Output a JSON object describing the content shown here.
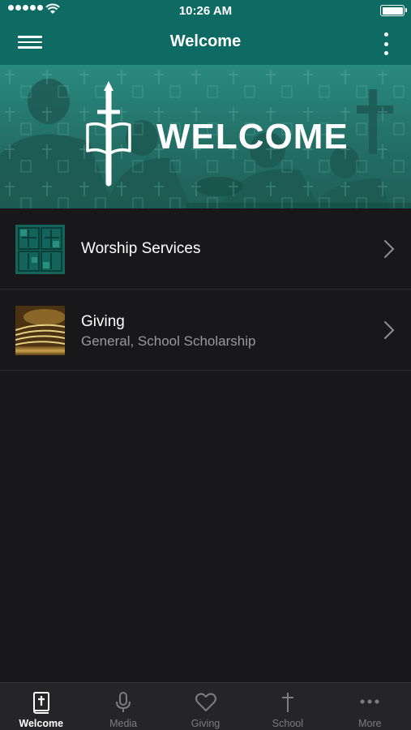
{
  "status_bar": {
    "time": "10:26 AM"
  },
  "navbar": {
    "title": "Welcome",
    "menu_icon": "hamburger-menu-icon",
    "more_icon": "vertical-ellipsis-icon"
  },
  "banner": {
    "text": "WELCOME",
    "logo_icon": "sword-bible-cross-icon"
  },
  "list": {
    "items": [
      {
        "title": "Worship Services",
        "subtitle": "",
        "thumb_icon": "stained-glass-thumbnail"
      },
      {
        "title": "Giving",
        "subtitle": "General, School Scholarship",
        "thumb_icon": "offering-plate-thumbnail"
      }
    ]
  },
  "tabs": [
    {
      "label": "Welcome",
      "icon": "bible-icon",
      "active": true
    },
    {
      "label": "Media",
      "icon": "microphone-icon",
      "active": false
    },
    {
      "label": "Giving",
      "icon": "heart-icon",
      "active": false
    },
    {
      "label": "School",
      "icon": "cross-icon",
      "active": false
    },
    {
      "label": "More",
      "icon": "ellipsis-icon",
      "active": false
    }
  ],
  "colors": {
    "brand": "#0e6b63",
    "background": "#18181a",
    "tabbar": "#252527",
    "inactive": "#7d7d80"
  }
}
